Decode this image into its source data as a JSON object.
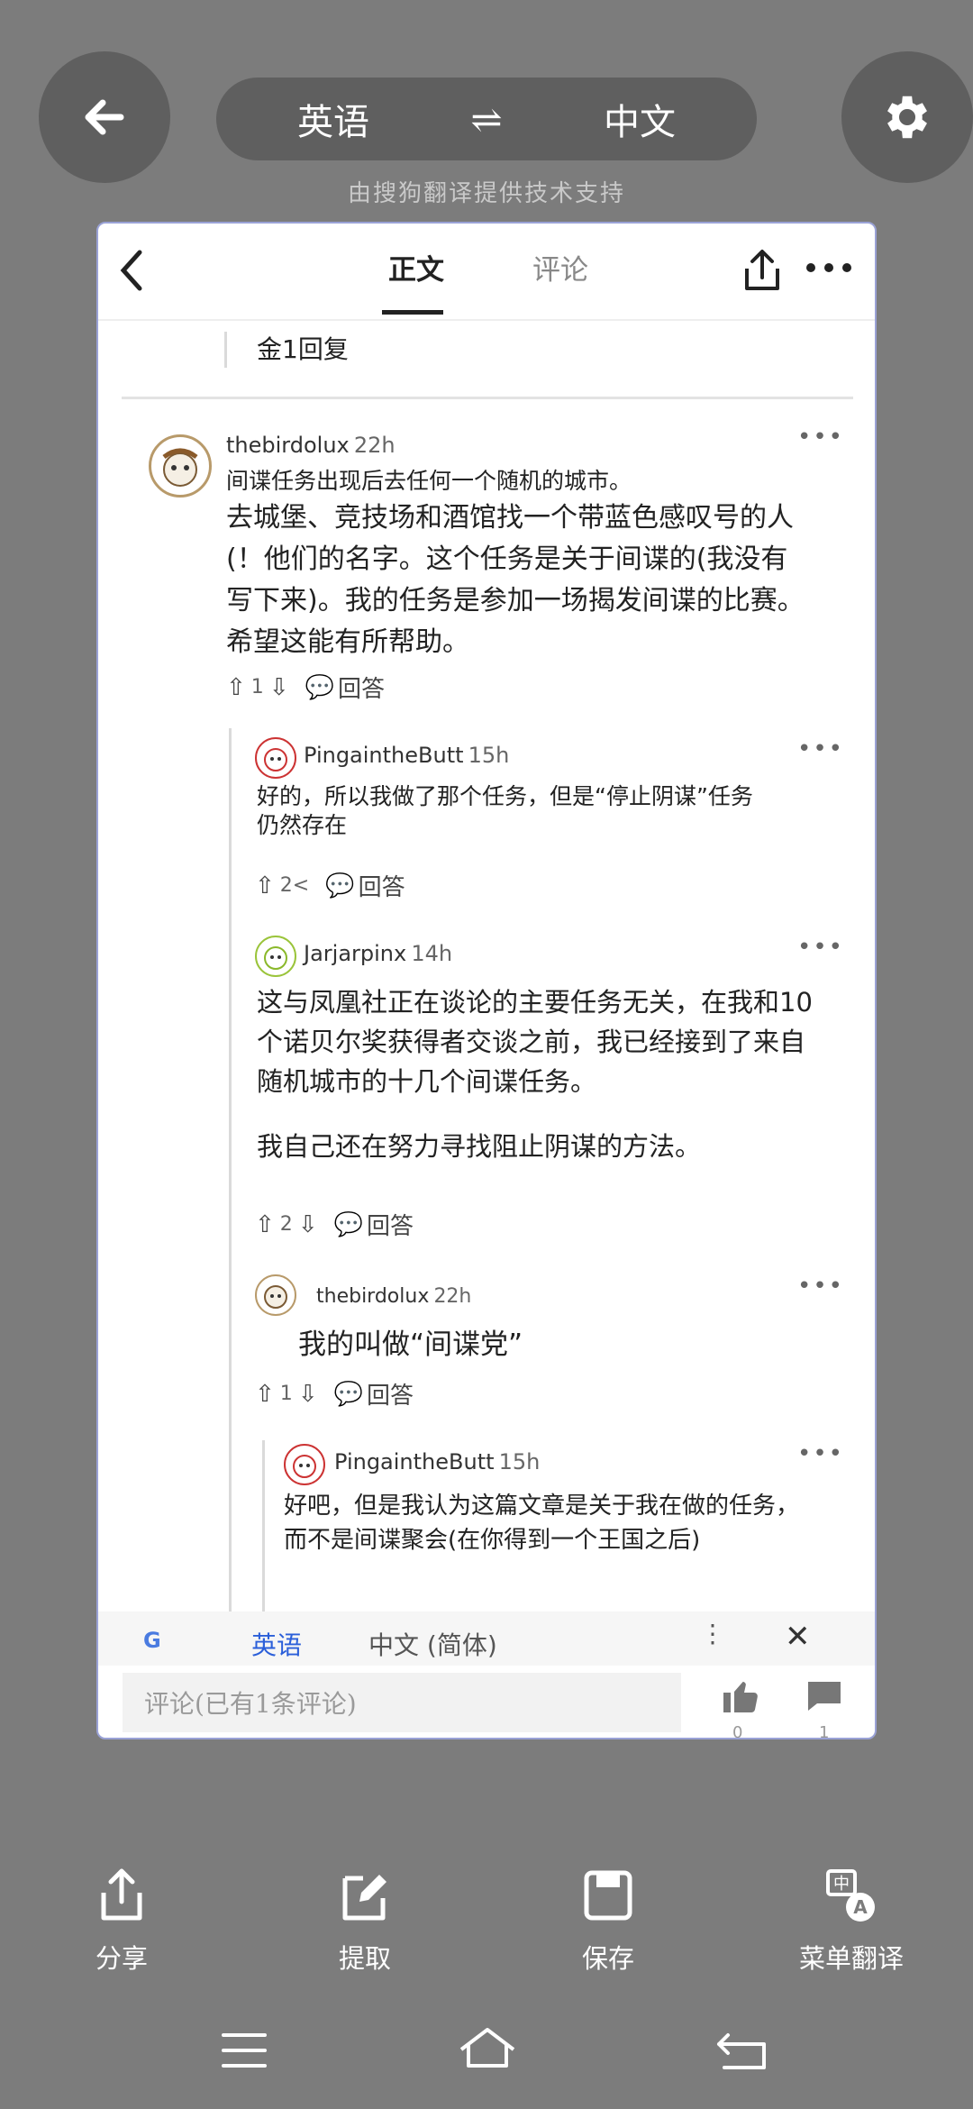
{
  "toolbar": {
    "source_lang": "英语",
    "swap_icon": "swap-arrows-icon",
    "target_lang": "中文",
    "powered_by": "由搜狗翻译提供技术支持"
  },
  "article": {
    "tabs": [
      "正文",
      "评论"
    ],
    "active_tab": "正文",
    "prev_reply_text": "金1回复",
    "comments": [
      {
        "user": "thebirdolux",
        "time": "22h",
        "text_small": "间谍任务出现后去任何一个随机的城市。",
        "text_large": "去城堡、竞技场和酒馆找一个带蓝色感叹号的人(！他们的名字。这个任务是关于间谍的(我没有写下来)。我的任务是参加一场揭发间谍的比赛。希望这能有所帮助。",
        "votes": "1",
        "reply": "回答"
      },
      {
        "user": "PingaintheButt",
        "time": "15h",
        "text": "好的，所以我做了那个任务，但是“停止阴谋”任务仍然存在",
        "votes": "2<",
        "reply": "回答"
      },
      {
        "user": "Jarjarpinx",
        "time": "14h",
        "text_p1": "这与凤凰社正在谈论的主要任务无关，在我和10个诺贝尔奖获得者交谈之前，我已经接到了来自随机城市的十几个间谍任务。",
        "text_p2": "我自己还在努力寻找阻止阴谋的方法。",
        "votes": "2",
        "reply": "回答"
      },
      {
        "user": "thebirdolux",
        "time": "22h",
        "text": "我的叫做“间谍党”",
        "votes": "1",
        "reply": "回答"
      },
      {
        "user": "PingaintheButt",
        "time": "15h",
        "text": "好吧，但是我认为这篇文章是关于我在做的任务，而不是间谍聚会(在你得到一个王国之后)"
      }
    ]
  },
  "translate_bar": {
    "source": "英语",
    "target": "中文 (简体)"
  },
  "comment_box": {
    "placeholder": "评论(已有1条评论)",
    "likes": "0",
    "comments": "1"
  },
  "bottom_actions": [
    "分享",
    "提取",
    "保存",
    "菜单翻译"
  ],
  "colors": {
    "background": "#7c7c7c",
    "pill": "#5f5f5f",
    "translate_blue": "#2b5fd9"
  }
}
